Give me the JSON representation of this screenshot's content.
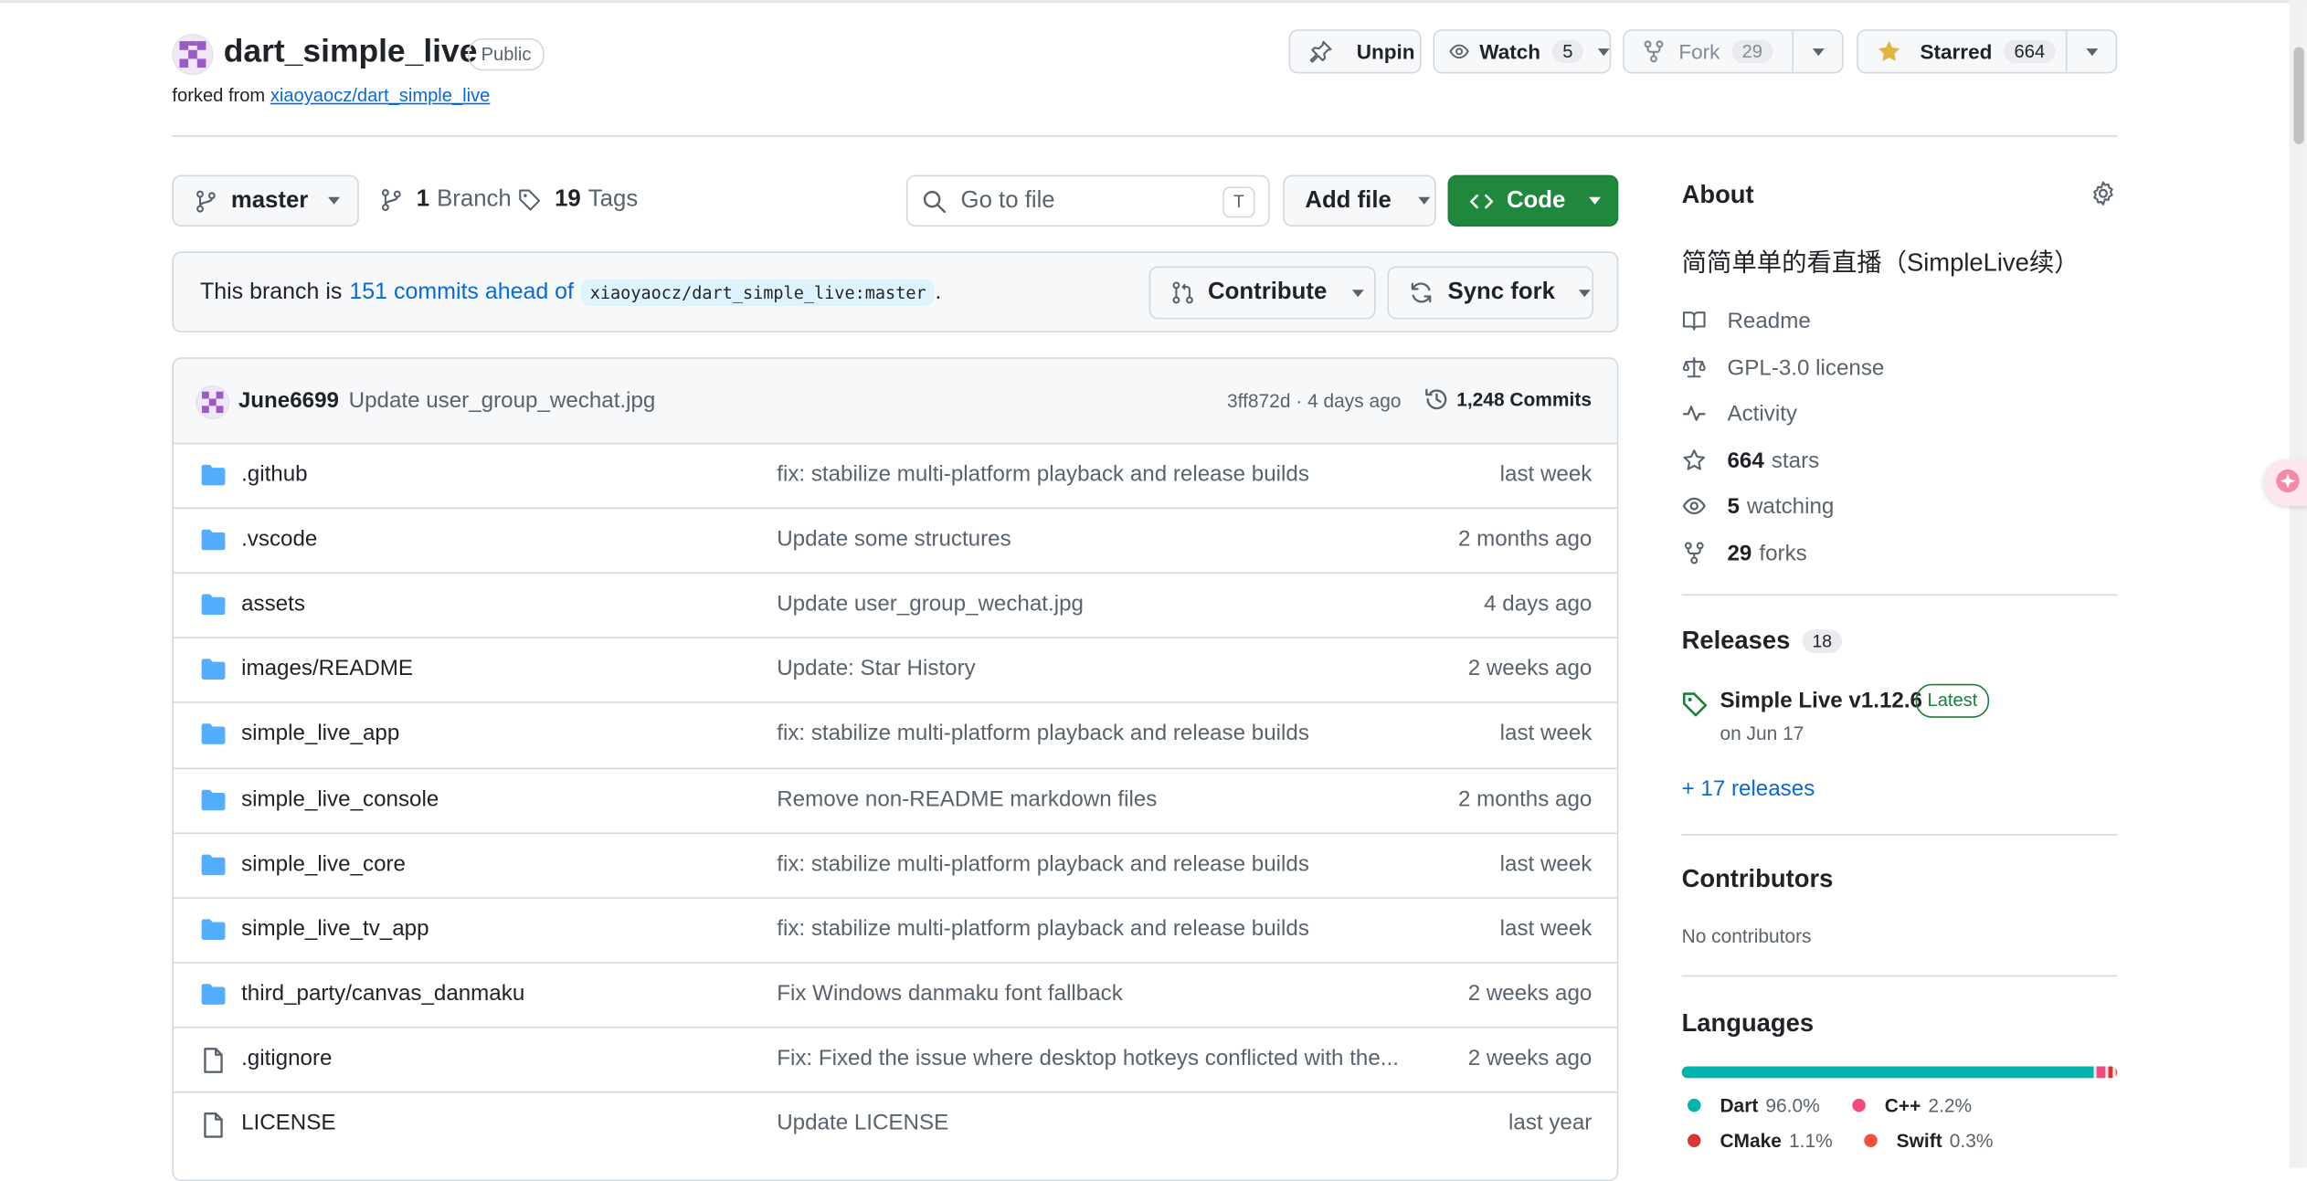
{
  "repo": {
    "name": "dart_simple_live",
    "visibility": "Public",
    "forked_from_prefix": "forked from",
    "forked_from": "xiaoyaocz/dart_simple_live"
  },
  "actions": {
    "unpin": "Unpin",
    "watch": "Watch",
    "watch_count": "5",
    "fork": "Fork",
    "fork_count": "29",
    "starred": "Starred",
    "star_count": "664"
  },
  "toolbar": {
    "branch": "master",
    "branch_count": "1",
    "branch_label": "Branch",
    "tag_count": "19",
    "tag_label": "Tags",
    "goto_placeholder": "Go to file",
    "goto_shortcut": "T",
    "add_file": "Add file",
    "code": "Code"
  },
  "fork_banner": {
    "prefix": "This branch is",
    "commits_ahead": "151 commits ahead of",
    "upstream_ref": "xiaoyaocz/dart_simple_live:master",
    "suffix": ".",
    "contribute": "Contribute",
    "sync_fork": "Sync fork"
  },
  "latest_commit": {
    "author": "June6699",
    "message": "Update user_group_wechat.jpg",
    "sha_time": "3ff872d · 4 days ago",
    "commits": "1,248 Commits"
  },
  "files": [
    {
      "name": ".github",
      "type": "folder",
      "message": "fix: stabilize multi-platform playback and release builds",
      "time": "last week"
    },
    {
      "name": ".vscode",
      "type": "folder",
      "message": "Update some structures",
      "time": "2 months ago"
    },
    {
      "name": "assets",
      "type": "folder",
      "message": "Update user_group_wechat.jpg",
      "time": "4 days ago"
    },
    {
      "name": "images/README",
      "type": "folder",
      "message": "Update: Star History",
      "time": "2 weeks ago"
    },
    {
      "name": "simple_live_app",
      "type": "folder",
      "message": "fix: stabilize multi-platform playback and release builds",
      "time": "last week"
    },
    {
      "name": "simple_live_console",
      "type": "folder",
      "message": "Remove non-README markdown files",
      "time": "2 months ago"
    },
    {
      "name": "simple_live_core",
      "type": "folder",
      "message": "fix: stabilize multi-platform playback and release builds",
      "time": "last week"
    },
    {
      "name": "simple_live_tv_app",
      "type": "folder",
      "message": "fix: stabilize multi-platform playback and release builds",
      "time": "last week"
    },
    {
      "name": "third_party/canvas_danmaku",
      "type": "folder",
      "message": "Fix Windows danmaku font fallback",
      "time": "2 weeks ago"
    },
    {
      "name": ".gitignore",
      "type": "file",
      "message": "Fix: Fixed the issue where desktop hotkeys conflicted with the...",
      "time": "2 weeks ago"
    },
    {
      "name": "LICENSE",
      "type": "file",
      "message": "Update LICENSE",
      "time": "last year"
    }
  ],
  "about": {
    "heading": "About",
    "description": "简简单单的看直播（SimpleLive续）",
    "readme": "Readme",
    "license": "GPL-3.0 license",
    "activity": "Activity",
    "stars_count": "664",
    "stars_label": "stars",
    "watching_count": "5",
    "watching_label": "watching",
    "forks_count": "29",
    "forks_label": "forks"
  },
  "releases": {
    "heading": "Releases",
    "count": "18",
    "latest_name": "Simple Live v1.12.6",
    "latest_badge": "Latest",
    "latest_date": "on Jun 17",
    "more": "+ 17 releases"
  },
  "contributors": {
    "heading": "Contributors",
    "empty": "No contributors"
  },
  "languages": {
    "heading": "Languages",
    "items": [
      {
        "name": "Dart",
        "percent": "96.0%",
        "value": 96.0,
        "color": "#00B4AB"
      },
      {
        "name": "C++",
        "percent": "2.2%",
        "value": 2.2,
        "color": "#f34b7d"
      },
      {
        "name": "CMake",
        "percent": "1.1%",
        "value": 1.1,
        "color": "#DA3434"
      },
      {
        "name": "Swift",
        "percent": "0.3%",
        "value": 0.3,
        "color": "#F05138"
      }
    ]
  },
  "colors": {
    "accent": "#0969da",
    "primary_button": "#1f883d",
    "folder": "#54aeff",
    "star": "#e3b341"
  }
}
